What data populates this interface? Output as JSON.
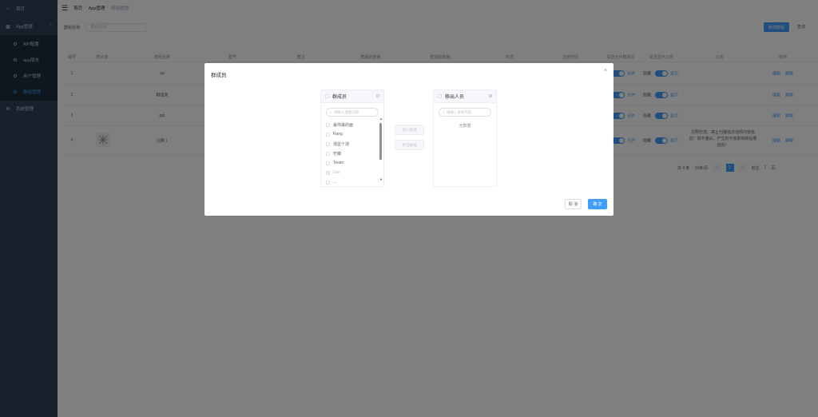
{
  "sidebar": {
    "home": "首页",
    "app_manage": "App管理",
    "items": [
      "API配置",
      "app版本",
      "用户管理",
      "群组管理"
    ],
    "system": "系统管理"
  },
  "header": {
    "breadcrumb": [
      "首页",
      "App管理",
      "群组管理"
    ]
  },
  "search": {
    "label": "群组名称:",
    "placeholder": "群组名称"
  },
  "toolbar": {
    "add_label": "新增群组",
    "refresh_label": "查询"
  },
  "table": {
    "headers": [
      "编号",
      "群头像",
      "群组名称",
      "群号",
      "群主",
      "群组的数量",
      "群组的数量",
      "状态",
      "注册时间",
      "是否允许群消息",
      "是否显示公告",
      "公告",
      "操作"
    ],
    "rows": [
      {
        "no": "1",
        "name": "aa",
        "toggle1_label": "允许",
        "toggle2_prefix": "隐藏",
        "toggle2_label": "显示",
        "edit": "编辑",
        "del": "解散"
      },
      {
        "no": "2",
        "name": "群组来",
        "toggle1_label": "允许",
        "toggle2_prefix": "隐藏",
        "toggle2_label": "显示",
        "edit": "编辑",
        "del": "解散"
      },
      {
        "no": "3",
        "name": "ppt",
        "toggle1_label": "允许",
        "toggle2_prefix": "隐藏",
        "toggle2_label": "显示",
        "edit": "编辑",
        "del": "解散"
      },
      {
        "no": "4",
        "name": "公群 1",
        "toggle1_label": "允许",
        "toggle2_prefix": "隐藏",
        "toggle2_label": "显示",
        "edit": "编辑",
        "del": "解散",
        "note": "文明交流，禁止刊播违法违规内容信息！如不遵从，产生的不良影响和后果自负！"
      }
    ]
  },
  "pager": {
    "total": "共 4 条",
    "size": "10条/页",
    "prev": "<",
    "page": "1",
    "next": ">",
    "goto": "前往",
    "goto_value": "1",
    "page_suffix": "页"
  },
  "dialog": {
    "title": "群成员",
    "close": "×",
    "left_title": "群成员",
    "left_count": "0/",
    "right_title": "移出人员",
    "right_count": "0/",
    "filter_placeholder": "请输入搜索内容",
    "members": [
      "最帅最的画",
      "Rang",
      "测显个测",
      "柠檬",
      "Tester",
      "Dan",
      "..."
    ],
    "empty": "无数据",
    "move_in": "加入群组",
    "move_out": "移出群组",
    "cancel": "取 消",
    "ok": "确 定"
  },
  "colors": {
    "primary": "#409eff",
    "sidebar": "#304156"
  }
}
